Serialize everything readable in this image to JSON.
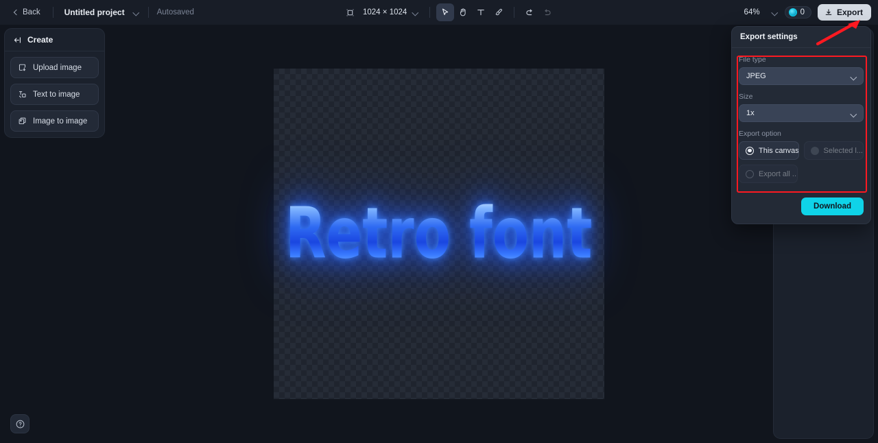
{
  "topbar": {
    "back_label": "Back",
    "project_name": "Untitled project",
    "autosave_status": "Autosaved",
    "canvas_size": "1024 × 1024",
    "zoom_level": "64%",
    "credits_count": "0",
    "export_label": "Export",
    "tools": [
      {
        "name": "frame-icon",
        "title": "Frame"
      },
      {
        "name": "cursor-icon",
        "title": "Select"
      },
      {
        "name": "hand-icon",
        "title": "Pan"
      },
      {
        "name": "text-icon",
        "title": "Text"
      },
      {
        "name": "brush-icon",
        "title": "Brush"
      },
      {
        "name": "undo-icon",
        "title": "Undo"
      },
      {
        "name": "redo-icon",
        "title": "Redo"
      }
    ]
  },
  "left_panel": {
    "title": "Create",
    "items": [
      {
        "label": "Upload image",
        "icon": "upload-image-icon"
      },
      {
        "label": "Text to image",
        "icon": "text-to-image-icon"
      },
      {
        "label": "Image to image",
        "icon": "image-to-image-icon"
      }
    ]
  },
  "canvas": {
    "artwork_text": "Retro font"
  },
  "export_panel": {
    "title": "Export settings",
    "file_type_label": "File type",
    "file_type_value": "JPEG",
    "size_label": "Size",
    "size_value": "1x",
    "export_option_label": "Export option",
    "options": [
      {
        "label": "This canvas",
        "selected": true,
        "disabled": false
      },
      {
        "label": "Selected l...",
        "selected": false,
        "disabled": true
      },
      {
        "label": "Export all ...",
        "selected": false,
        "disabled": true
      }
    ],
    "download_label": "Download"
  },
  "help": {
    "icon": "question-mark-icon"
  },
  "colors": {
    "accent_cyan": "#0fd3e8",
    "annotation_red": "#fe1921",
    "panel_bg": "#1b212c",
    "app_bg": "#11151d",
    "neon_blue": "#2f6bf2"
  }
}
